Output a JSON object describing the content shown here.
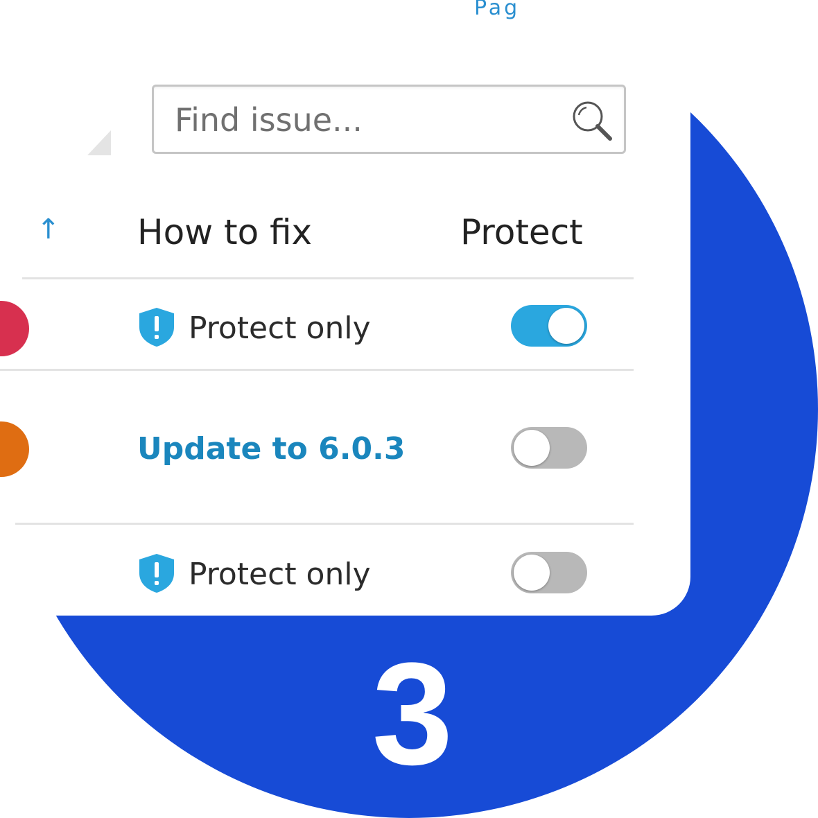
{
  "top_fragment": "Pag",
  "search": {
    "placeholder": "Find issue...",
    "icon": "search-icon"
  },
  "table": {
    "sort_indicator": "↑",
    "columns": {
      "how_to_fix": "How to fix",
      "protect": "Protect"
    },
    "rows": [
      {
        "severity_color": "#d7304f",
        "fix_label": "Protect only",
        "fix_icon": "shield-alert-icon",
        "fix_is_link": false,
        "protect_on": true
      },
      {
        "severity_color": "#df6d12",
        "fix_label": "Update to 6.0.3",
        "fix_icon": null,
        "fix_is_link": true,
        "protect_on": false
      },
      {
        "severity_color": null,
        "fix_label": "Protect only",
        "fix_icon": "shield-alert-icon",
        "fix_is_link": false,
        "protect_on": false
      }
    ]
  },
  "step": "3",
  "colors": {
    "accent_blue": "#174bd6",
    "toggle_on": "#2aa7df",
    "toggle_off": "#b8b8b8",
    "link": "#1a86bd",
    "shield": "#2aa7df"
  }
}
